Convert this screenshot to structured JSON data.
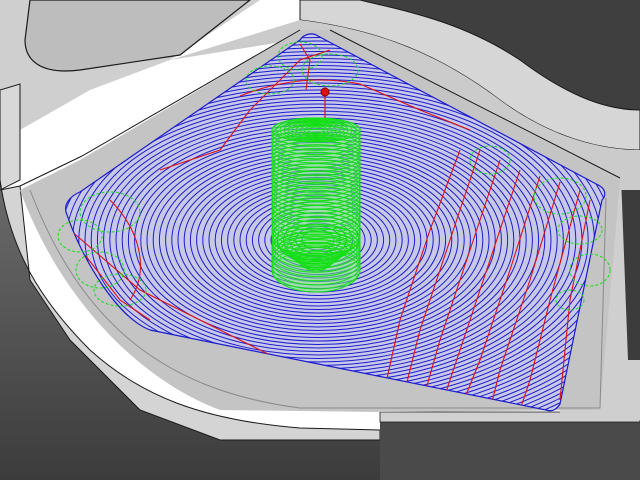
{
  "viewport": {
    "background": "#ffffff"
  },
  "part": {
    "floor_color": "#c9c9c9",
    "wall_top_color": "#d2d2d2",
    "wall_side_color": "#525252",
    "wall_side_dark_color": "#3a3a3a",
    "edge_color": "#1a1a1a"
  },
  "toolpath": {
    "colors": {
      "cut": "#1c1ccf",
      "link": "#e01010",
      "rapid": "#12e012"
    },
    "start_marker_color": "#e01010",
    "tool_icon": "end-mill-tool"
  }
}
